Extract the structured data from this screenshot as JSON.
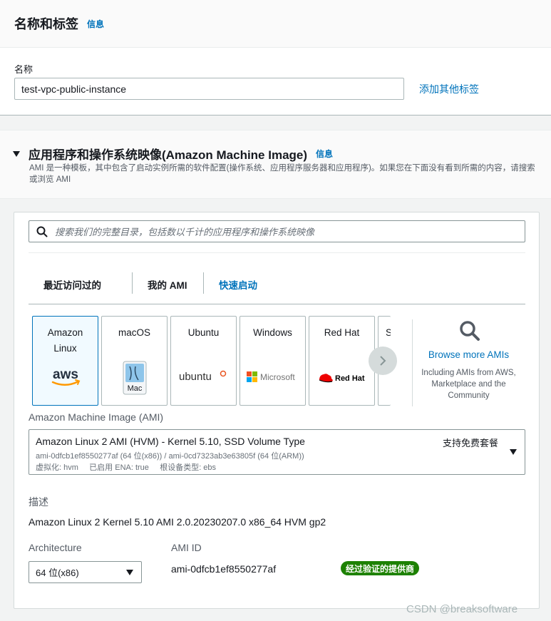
{
  "name_tags": {
    "title": "名称和标签",
    "info": "信息",
    "name_label": "名称",
    "name_value": "test-vpc-public-instance",
    "add_tags": "添加其他标签"
  },
  "ami_section": {
    "title": "应用程序和操作系统映像(Amazon Machine Image)",
    "info": "信息",
    "description": "AMI 是一种模板，其中包含了启动实例所需的软件配置(操作系统、应用程序服务器和应用程序)。如果您在下面没有看到所需的内容，请搜索或浏览 AMI",
    "search_placeholder": "搜索我们的完整目录，包括数以千计的应用程序和操作系统映像",
    "tabs": [
      {
        "label": "最近访问过的"
      },
      {
        "label": "我的 AMI"
      },
      {
        "label": "快速启动"
      }
    ],
    "os_tiles": [
      {
        "name": "Amazon Linux",
        "logo": "aws"
      },
      {
        "name": "macOS",
        "logo": "Mac"
      },
      {
        "name": "Ubuntu",
        "logo": "ubuntu"
      },
      {
        "name": "Windows",
        "logo": "Microsoft"
      },
      {
        "name": "Red Hat",
        "logo": "Red Hat"
      },
      {
        "name": "S"
      }
    ],
    "browse_more": "Browse more AMIs",
    "browse_desc": "Including AMIs from AWS, Marketplace and the Community",
    "ami_label": "Amazon Machine Image (AMI)",
    "selected_ami": {
      "title": "Amazon Linux 2 AMI (HVM) - Kernel 5.10, SSD Volume Type",
      "free_tier": "支持免费套餐",
      "ids": "ami-0dfcb1ef8550277af (64 位(x86)) / ami-0cd7323ab3e63805f (64 位(ARM))",
      "meta": "虚拟化: hvm     已启用 ENA: true     根设备类型: ebs"
    },
    "desc_label": "描述",
    "desc_value": "Amazon Linux 2 Kernel 5.10 AMI 2.0.20230207.0 x86_64 HVM gp2",
    "arch_label": "Architecture",
    "arch_value": "64 位(x86)",
    "ami_id_label": "AMI ID",
    "ami_id_value": "ami-0dfcb1ef8550277af",
    "verified_badge": "经过验证的提供商"
  },
  "watermark": "CSDN @breaksoftware",
  "colors": {
    "link": "#0073bb",
    "verified_green": "#1d8102",
    "selected_tile_border": "#0073bb"
  }
}
